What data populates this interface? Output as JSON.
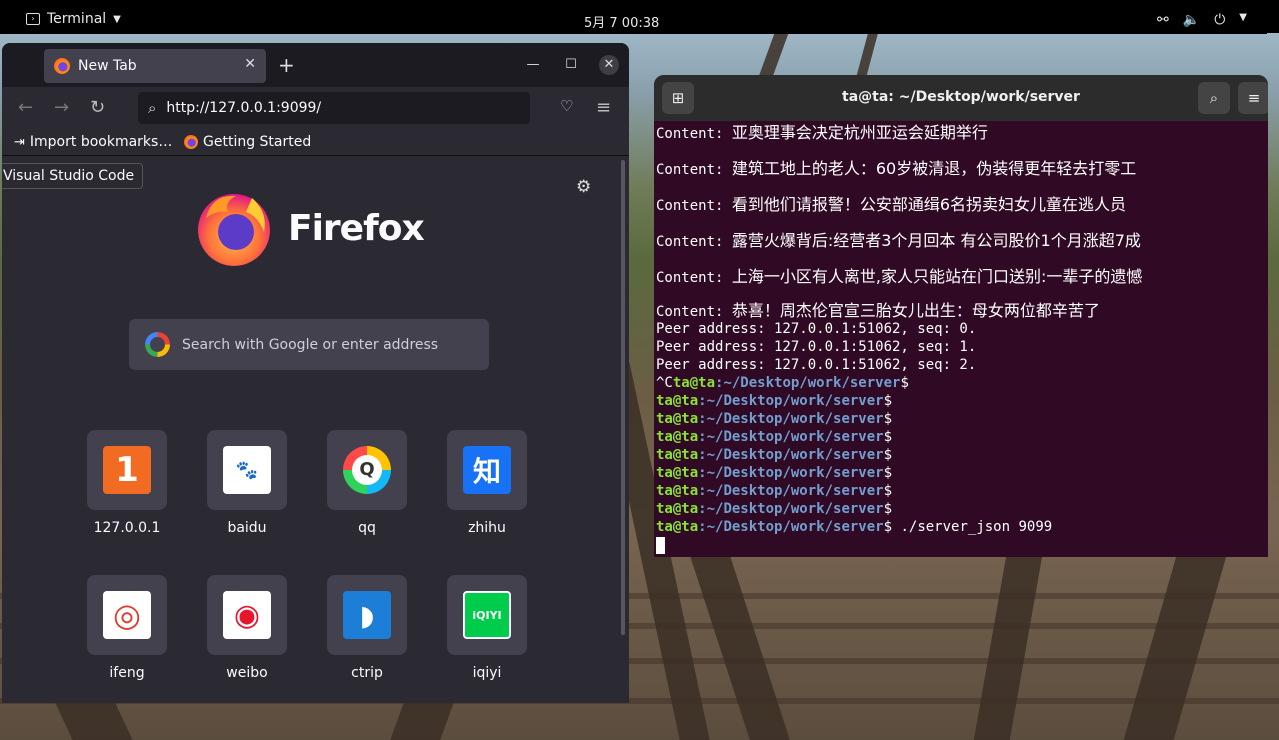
{
  "topbar": {
    "app_name": "Terminal",
    "clock": "5月 7  00:38"
  },
  "firefox": {
    "tab_title": "New Tab",
    "url": "http://127.0.0.1:9099/",
    "bookmarks": [
      "Import bookmarks…",
      "Getting Started"
    ],
    "tooltip": "Visual Studio Code",
    "logo_text": "Firefox",
    "search_placeholder": "Search with Google or enter address",
    "tiles": [
      {
        "label": "127.0.0.1",
        "glyph": "1",
        "color": "#f26b22"
      },
      {
        "label": "baidu",
        "glyph": "du",
        "color": "#ffffff"
      },
      {
        "label": "qq",
        "glyph": "Q",
        "color": "#ffffff"
      },
      {
        "label": "zhihu",
        "glyph": "知",
        "color": "#1772f6"
      },
      {
        "label": "ifeng",
        "glyph": "◎",
        "color": "#ffffff"
      },
      {
        "label": "weibo",
        "glyph": "◉",
        "color": "#ffffff"
      },
      {
        "label": "ctrip",
        "glyph": "◗",
        "color": "#1c7ed6"
      },
      {
        "label": "iqiyi",
        "glyph": "iQIYI",
        "color": "#00cc4c"
      }
    ]
  },
  "terminal": {
    "title": "ta@ta: ~/Desktop/work/server",
    "content_lines": [
      "亚奥理事会决定杭州亚运会延期举行",
      "建筑工地上的老人：60岁被清退，伪装得更年轻去打零工",
      "看到他们请报警！公安部通缉6名拐卖妇女儿童在逃人员",
      "露营火爆背后:经营者3个月回本 有公司股价1个月涨超7成",
      "上海一小区有人离世,家人只能站在门口送别:一辈子的遗憾",
      "恭喜！周杰伦官宣三胎女儿出生：母女两位都辛苦了"
    ],
    "content_prefix": "Content: ",
    "peer_lines": [
      "Peer address: 127.0.0.1:51062, seq: 0.",
      "Peer address: 127.0.0.1:51062, seq: 1.",
      "Peer address: 127.0.0.1:51062, seq: 2."
    ],
    "ctrl_c": "^C",
    "prompt_user": "ta@ta",
    "prompt_path": ":~/Desktop/work/server",
    "prompt_symbol": "$",
    "empty_prompts": 7,
    "last_command": " ./server_json 9099"
  }
}
